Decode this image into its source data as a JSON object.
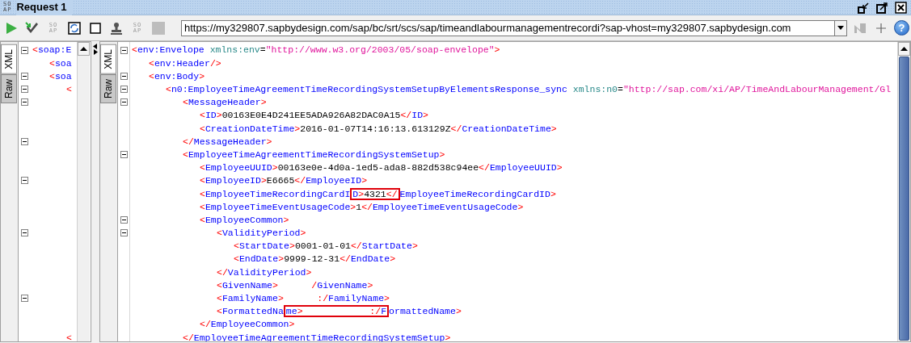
{
  "window": {
    "title": "Request 1",
    "logo": [
      "SO",
      "AP"
    ]
  },
  "toolbar": {
    "buttons": [
      {
        "kind": "run"
      },
      {
        "kind": "check"
      },
      {
        "kind": "soap",
        "text": [
          "SO",
          "AP"
        ]
      },
      {
        "kind": "refresh"
      },
      {
        "kind": "square"
      },
      {
        "kind": "stamp"
      },
      {
        "kind": "soap",
        "text": [
          "SO",
          "AP"
        ]
      },
      {
        "kind": "stop"
      }
    ],
    "url": "https://my329807.sapbydesign.com/sap/bc/srt/scs/sap/timeandlabourmanagementrecordi?sap-vhost=my329807.sapbydesign.com",
    "end_buttons": [
      {
        "kind": "tool"
      },
      {
        "kind": "plus"
      },
      {
        "kind": "help",
        "text": "?"
      }
    ]
  },
  "request_pane": {
    "tabs": [
      {
        "label": "XML",
        "selected": true
      },
      {
        "label": "Raw",
        "selected": false
      }
    ],
    "lines": [
      {
        "fold": true,
        "tokens": [
          {
            "kind": "punct",
            "text": "<"
          },
          {
            "kind": "tag",
            "text": "soap:E"
          }
        ],
        "children": [
          {
            "fold": false,
            "tokens": [
              {
                "kind": "punct",
                "text": "<"
              },
              {
                "kind": "tag",
                "text": "soa"
              }
            ]
          },
          {
            "fold": true,
            "tokens": [
              {
                "kind": "punct",
                "text": "<"
              },
              {
                "kind": "tag",
                "text": "soa"
              }
            ],
            "children": [
              {
                "fold": true,
                "tokens": [
                  {
                    "kind": "punct",
                    "text": "<"
                  }
                ],
                "children": [
                  {
                    "fold": true
                  },
                  {
                    "fold": false
                  },
                  {
                    "fold": false
                  },
                  {
                    "fold": true
                  },
                  {
                    "fold": false
                  },
                  {
                    "fold": false
                  },
                  {
                    "fold": true
                  },
                  {
                    "fold": false
                  },
                  {
                    "fold": false
                  },
                  {
                    "fold": false
                  },
                  {
                    "fold": true
                  },
                  {
                    "fold": false
                  },
                  {
                    "fold": false
                  },
                  {
                    "fold": false
                  },
                  {
                    "fold": false
                  },
                  {
                    "fold": true
                  },
                  {
                    "fold": false
                  },
                  {
                    "fold": false
                  }
                ]
              },
              {
                "fold": false,
                "tokens": [
                  {
                    "kind": "punct",
                    "text": "<"
                  }
                ]
              }
            ]
          }
        ]
      }
    ]
  },
  "response_pane": {
    "tabs": [
      {
        "label": "XML",
        "selected": true
      },
      {
        "label": "Raw",
        "selected": false
      }
    ],
    "lines": [
      {
        "fold": true,
        "tokens": [
          {
            "kind": "punct",
            "text": "<"
          },
          {
            "kind": "tag",
            "text": "env:Envelope"
          },
          {
            "kind": "attr",
            "text": "xmlns:env"
          },
          {
            "kind": "eq",
            "text": "="
          },
          {
            "kind": "value",
            "text": "\"http://www.w3.org/2003/05/soap-envelope\""
          },
          {
            "kind": "punct",
            "text": ">"
          }
        ],
        "children": [
          {
            "fold": false,
            "tokens": [
              {
                "kind": "punct",
                "text": "<"
              },
              {
                "kind": "tag",
                "text": "env:Header"
              },
              {
                "kind": "punct",
                "text": "/>"
              }
            ]
          },
          {
            "fold": true,
            "tokens": [
              {
                "kind": "punct",
                "text": "<"
              },
              {
                "kind": "tag",
                "text": "env:Body"
              },
              {
                "kind": "punct",
                "text": ">"
              }
            ],
            "children": [
              {
                "fold": true,
                "tokens": [
                  {
                    "kind": "punct",
                    "text": "<"
                  },
                  {
                    "kind": "tag",
                    "text": "n0:EmployeeTimeAgreementTimeRecordingSystemSetupByElementsResponse_sync"
                  },
                  {
                    "kind": "attr",
                    "text": "xmlns:n0"
                  },
                  {
                    "kind": "eq",
                    "text": "="
                  },
                  {
                    "kind": "value",
                    "text": "\"http://sap.com/xi/AP/TimeAndLabourManagement/Gl"
                  }
                ],
                "children": [
                  {
                    "fold": true,
                    "tokens": [
                      {
                        "kind": "punct",
                        "text": "<"
                      },
                      {
                        "kind": "tag",
                        "text": "MessageHeader"
                      },
                      {
                        "kind": "punct",
                        "text": ">"
                      }
                    ],
                    "children": [
                      {
                        "fold": false,
                        "tokens": [
                          {
                            "kind": "punct",
                            "text": "<"
                          },
                          {
                            "kind": "tag",
                            "text": "ID"
                          },
                          {
                            "kind": "punct",
                            "text": ">"
                          },
                          {
                            "kind": "text",
                            "text": "00163E0E4D241EE5ADA926A82DAC0A15"
                          },
                          {
                            "kind": "punct",
                            "text": "</"
                          },
                          {
                            "kind": "tag",
                            "text": "ID"
                          },
                          {
                            "kind": "punct",
                            "text": ">"
                          }
                        ]
                      },
                      {
                        "fold": false,
                        "tokens": [
                          {
                            "kind": "punct",
                            "text": "<"
                          },
                          {
                            "kind": "tag",
                            "text": "CreationDateTime"
                          },
                          {
                            "kind": "punct",
                            "text": ">"
                          },
                          {
                            "kind": "text",
                            "text": "2016-01-07T14:16:13.613129Z"
                          },
                          {
                            "kind": "punct",
                            "text": "</"
                          },
                          {
                            "kind": "tag",
                            "text": "CreationDateTime"
                          },
                          {
                            "kind": "punct",
                            "text": ">"
                          }
                        ]
                      }
                    ]
                  },
                  {
                    "fold": false,
                    "tokens": [
                      {
                        "kind": "punct",
                        "text": "</"
                      },
                      {
                        "kind": "tag",
                        "text": "MessageHeader"
                      },
                      {
                        "kind": "punct",
                        "text": ">"
                      }
                    ]
                  },
                  {
                    "fold": true,
                    "tokens": [
                      {
                        "kind": "punct",
                        "text": "<"
                      },
                      {
                        "kind": "tag",
                        "text": "EmployeeTimeAgreementTimeRecordingSystemSetup"
                      },
                      {
                        "kind": "punct",
                        "text": ">"
                      }
                    ],
                    "children": [
                      {
                        "fold": false,
                        "tokens": [
                          {
                            "kind": "punct",
                            "text": "<"
                          },
                          {
                            "kind": "tag",
                            "text": "EmployeeUUID"
                          },
                          {
                            "kind": "punct",
                            "text": ">"
                          },
                          {
                            "kind": "text",
                            "text": "00163e0e-4d0a-1ed5-ada8-882d538c94ee"
                          },
                          {
                            "kind": "punct",
                            "text": "</"
                          },
                          {
                            "kind": "tag",
                            "text": "EmployeeUUID"
                          },
                          {
                            "kind": "punct",
                            "text": ">"
                          }
                        ]
                      },
                      {
                        "fold": false,
                        "tokens": [
                          {
                            "kind": "punct",
                            "text": "<"
                          },
                          {
                            "kind": "tag",
                            "text": "EmployeeID"
                          },
                          {
                            "kind": "punct",
                            "text": ">"
                          },
                          {
                            "kind": "text",
                            "text": "E6665"
                          },
                          {
                            "kind": "punct",
                            "text": "</"
                          },
                          {
                            "kind": "tag",
                            "text": "EmployeeID"
                          },
                          {
                            "kind": "punct",
                            "text": ">"
                          }
                        ]
                      },
                      {
                        "fold": false,
                        "tokens": [
                          {
                            "kind": "punct",
                            "text": "<"
                          },
                          {
                            "kind": "tag",
                            "text": "EmployeeTimeRecordingCardI"
                          },
                          {
                            "kind": "highlight",
                            "tokens": [
                              {
                                "kind": "tag",
                                "text": "D"
                              },
                              {
                                "kind": "punct",
                                "text": ">"
                              },
                              {
                                "kind": "text",
                                "text": "4321"
                              },
                              {
                                "kind": "punct",
                                "text": "</"
                              }
                            ]
                          },
                          {
                            "kind": "tag",
                            "text": "EmployeeTimeRecordingCardID"
                          },
                          {
                            "kind": "punct",
                            "text": ">"
                          }
                        ]
                      },
                      {
                        "fold": false,
                        "tokens": [
                          {
                            "kind": "punct",
                            "text": "<"
                          },
                          {
                            "kind": "tag",
                            "text": "EmployeeTimeEventUsageCode"
                          },
                          {
                            "kind": "punct",
                            "text": ">"
                          },
                          {
                            "kind": "text",
                            "text": "1"
                          },
                          {
                            "kind": "punct",
                            "text": "</"
                          },
                          {
                            "kind": "tag",
                            "text": "EmployeeTimeEventUsageCode"
                          },
                          {
                            "kind": "punct",
                            "text": ">"
                          }
                        ]
                      },
                      {
                        "fold": true,
                        "tokens": [
                          {
                            "kind": "punct",
                            "text": "<"
                          },
                          {
                            "kind": "tag",
                            "text": "EmployeeCommon"
                          },
                          {
                            "kind": "punct",
                            "text": ">"
                          }
                        ],
                        "children": [
                          {
                            "fold": true,
                            "tokens": [
                              {
                                "kind": "punct",
                                "text": "<"
                              },
                              {
                                "kind": "tag",
                                "text": "ValidityPeriod"
                              },
                              {
                                "kind": "punct",
                                "text": ">"
                              }
                            ],
                            "children": [
                              {
                                "fold": false,
                                "tokens": [
                                  {
                                    "kind": "punct",
                                    "text": "<"
                                  },
                                  {
                                    "kind": "tag",
                                    "text": "StartDate"
                                  },
                                  {
                                    "kind": "punct",
                                    "text": ">"
                                  },
                                  {
                                    "kind": "text",
                                    "text": "0001-01-01"
                                  },
                                  {
                                    "kind": "punct",
                                    "text": "</"
                                  },
                                  {
                                    "kind": "tag",
                                    "text": "StartDate"
                                  },
                                  {
                                    "kind": "punct",
                                    "text": ">"
                                  }
                                ]
                              },
                              {
                                "fold": false,
                                "tokens": [
                                  {
                                    "kind": "punct",
                                    "text": "<"
                                  },
                                  {
                                    "kind": "tag",
                                    "text": "EndDate"
                                  },
                                  {
                                    "kind": "punct",
                                    "text": ">"
                                  },
                                  {
                                    "kind": "text",
                                    "text": "9999-12-31"
                                  },
                                  {
                                    "kind": "punct",
                                    "text": "</"
                                  },
                                  {
                                    "kind": "tag",
                                    "text": "EndDate"
                                  },
                                  {
                                    "kind": "punct",
                                    "text": ">"
                                  }
                                ]
                              }
                            ]
                          },
                          {
                            "fold": false,
                            "tokens": [
                              {
                                "kind": "punct",
                                "text": "</"
                              },
                              {
                                "kind": "tag",
                                "text": "ValidityPeriod"
                              },
                              {
                                "kind": "punct",
                                "text": ">"
                              }
                            ]
                          },
                          {
                            "fold": false,
                            "tokens": [
                              {
                                "kind": "punct",
                                "text": "<"
                              },
                              {
                                "kind": "tag",
                                "text": "GivenName"
                              },
                              {
                                "kind": "punct",
                                "text": ">"
                              },
                              {
                                "kind": "redacted"
                              },
                              {
                                "kind": "punct",
                                "text": "/"
                              },
                              {
                                "kind": "tag",
                                "text": "GivenName"
                              },
                              {
                                "kind": "punct",
                                "text": ">"
                              }
                            ]
                          },
                          {
                            "fold": false,
                            "tokens": [
                              {
                                "kind": "punct",
                                "text": "<"
                              },
                              {
                                "kind": "tag",
                                "text": "FamilyName"
                              },
                              {
                                "kind": "punct",
                                "text": ">"
                              },
                              {
                                "kind": "redacted"
                              },
                              {
                                "kind": "punct",
                                "text": ":/"
                              },
                              {
                                "kind": "tag",
                                "text": "FamilyName"
                              },
                              {
                                "kind": "punct",
                                "text": ">"
                              }
                            ]
                          },
                          {
                            "fold": false,
                            "tokens": [
                              {
                                "kind": "punct",
                                "text": "<"
                              },
                              {
                                "kind": "tag",
                                "text": "FormattedNa"
                              },
                              {
                                "kind": "highlight",
                                "tokens": [
                                  {
                                    "kind": "tag",
                                    "text": "me"
                                  },
                                  {
                                    "kind": "punct",
                                    "text": ">"
                                  },
                                  {
                                    "kind": "redacted"
                                  },
                                  {
                                    "kind": "redacted"
                                  },
                                  {
                                    "kind": "punct",
                                    "text": ":/"
                                  },
                                  {
                                    "kind": "tag",
                                    "text": "F"
                                  }
                                ]
                              },
                              {
                                "kind": "tag",
                                "text": "ormattedName"
                              },
                              {
                                "kind": "punct",
                                "text": ">"
                              }
                            ]
                          }
                        ]
                      },
                      {
                        "fold": false,
                        "tokens": [
                          {
                            "kind": "punct",
                            "text": "</"
                          },
                          {
                            "kind": "tag",
                            "text": "EmployeeCommon"
                          },
                          {
                            "kind": "punct",
                            "text": ">"
                          }
                        ]
                      }
                    ]
                  },
                  {
                    "fold": false,
                    "tokens": [
                      {
                        "kind": "punct",
                        "text": "</"
                      },
                      {
                        "kind": "tag",
                        "text": "EmployeeTimeAgreementTimeRecordingSystemSetup"
                      },
                      {
                        "kind": "punct",
                        "text": ">"
                      }
                    ]
                  }
                ]
              }
            ]
          }
        ]
      }
    ]
  }
}
